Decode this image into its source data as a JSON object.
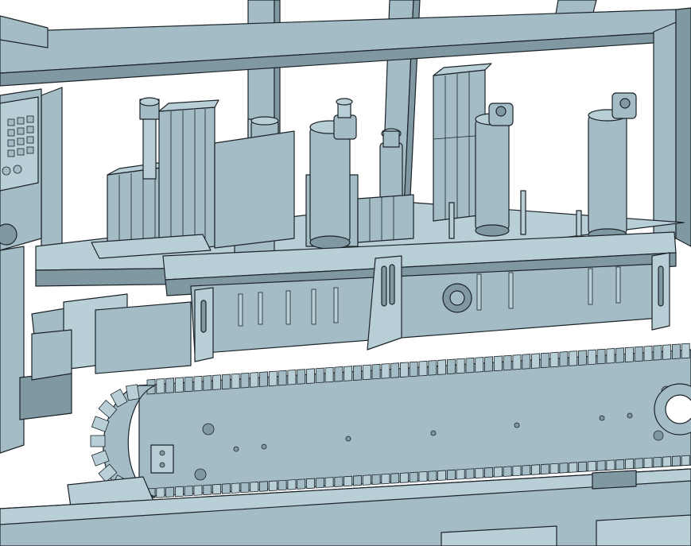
{
  "colors": {
    "background": "#ffffff",
    "model_surface": "#a3bcc6",
    "model_light": "#b9cfd7",
    "model_shadow": "#7f98a2",
    "model_dark": "#5f7782",
    "edge": "#1b2328"
  },
  "scene": {
    "parts": [
      "top-frame",
      "control-panel",
      "left-cylinder-group",
      "center-cylinder-group",
      "right-cylinder-group",
      "mounting-plate",
      "chain-conveyor",
      "base-plate"
    ]
  }
}
